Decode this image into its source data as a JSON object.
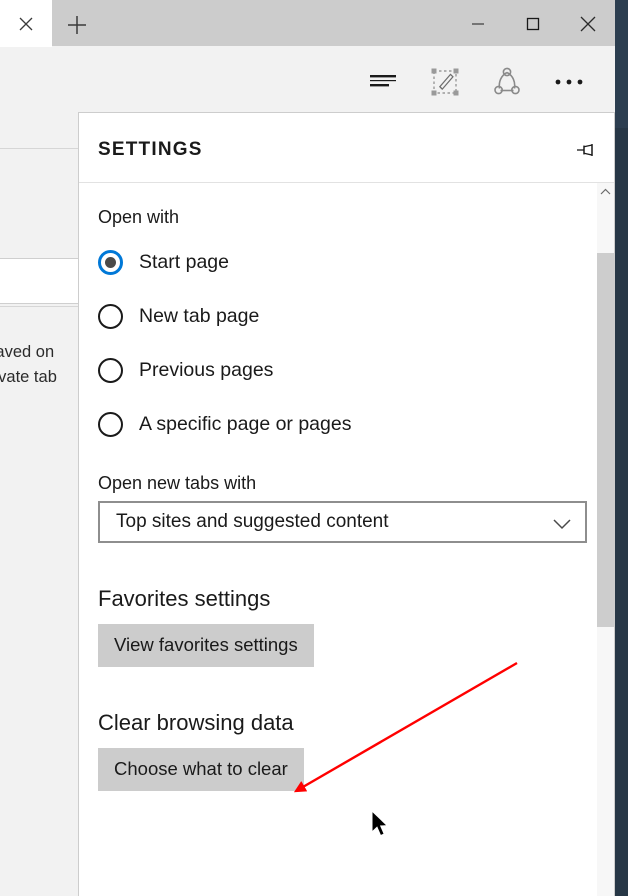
{
  "window": {
    "tab_close_icon": "close-icon",
    "new_tab_icon": "plus-icon",
    "minimize_label": "—",
    "maximize_label": "□",
    "close_label": "✕"
  },
  "toolbar": {
    "icons": [
      {
        "name": "reading-view-icon",
        "label": "Reading view"
      },
      {
        "name": "web-note-icon",
        "label": "Make a Web Note"
      },
      {
        "name": "share-icon",
        "label": "Share"
      },
      {
        "name": "more-icon",
        "label": "More"
      }
    ]
  },
  "page_behind": {
    "line1": "t saved on",
    "line2": "Private tab"
  },
  "settings": {
    "title": "SETTINGS",
    "pin_icon": "pin-icon",
    "open_with": {
      "label": "Open with",
      "options": [
        {
          "label": "Start page",
          "checked": true
        },
        {
          "label": "New tab page",
          "checked": false
        },
        {
          "label": "Previous pages",
          "checked": false
        },
        {
          "label": "A specific page or pages",
          "checked": false
        }
      ]
    },
    "open_new_tabs_with": {
      "label": "Open new tabs with",
      "selected": "Top sites and suggested content",
      "chevron_icon": "chevron-down-icon"
    },
    "favorites": {
      "heading": "Favorites settings",
      "button": "View favorites settings"
    },
    "clear_browsing_data": {
      "heading": "Clear browsing data",
      "button": "Choose what to clear"
    },
    "scrollbar": {
      "up_arrow_icon": "chevron-up-icon"
    }
  },
  "annotation": {
    "arrow_color": "#ff0000",
    "cursor_icon": "mouse-pointer-icon"
  },
  "colors": {
    "accent": "#0078d7",
    "button_gray": "#cccccc",
    "chrome_gray": "#cccccc",
    "toolbar_bg": "#f2f2f2",
    "desktop": "#273746"
  }
}
